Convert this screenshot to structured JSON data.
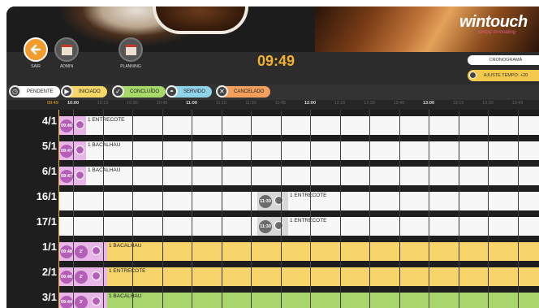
{
  "header": {
    "logo": "wintouch",
    "tagline": "simply innovating"
  },
  "toolbar": {
    "sair_label": "SAIR",
    "admin_label": "ADMIN",
    "planning_label": "PLANNING",
    "clock": "09:49",
    "cronograma_label": "CRONOGRAMA",
    "ajuste_label": "AJUSTE TEMPO: +20"
  },
  "legend": [
    {
      "label": "PENDENTE",
      "color": "#ffffff"
    },
    {
      "label": "INICIADO",
      "color": "#f7d768"
    },
    {
      "label": "CONCLUÍDO",
      "color": "#a6d96a"
    },
    {
      "label": "SERVIDO",
      "color": "#8fd3e8"
    },
    {
      "label": "CANCELADO",
      "color": "#f4a05c"
    }
  ],
  "timeline": {
    "now": "09:49",
    "ticks": [
      "10:00",
      "10:15",
      "10:30",
      "10:45",
      "11:00",
      "11:15",
      "11:30",
      "11:45",
      "12:00",
      "12:15",
      "12:30",
      "12:45",
      "13:00",
      "13:15",
      "13:30",
      "13:45"
    ],
    "rows": [
      {
        "table": "4/1",
        "time": "09:46",
        "elapsed": "",
        "item": "1 ENTRECOTE",
        "status": "pendente"
      },
      {
        "table": "5/1",
        "time": "09:47",
        "elapsed": "",
        "item": "1 BACALHAU",
        "status": "pendente"
      },
      {
        "table": "6/1",
        "time": "09:47",
        "elapsed": "",
        "item": "1 BACALHAU",
        "status": "pendente"
      },
      {
        "table": "16/1",
        "time": "11:30",
        "elapsed": "",
        "item": "1 ENTRECOTE",
        "status": "scheduled"
      },
      {
        "table": "17/1",
        "time": "11:30",
        "elapsed": "",
        "item": "1 ENTRECOTE",
        "status": "scheduled"
      },
      {
        "table": "1/1",
        "time": "09:48",
        "elapsed": "2'",
        "item": "1 BACALHAU",
        "status": "iniciado"
      },
      {
        "table": "2/1",
        "time": "09:46",
        "elapsed": "2'",
        "item": "1 ENTRECOTE",
        "status": "iniciado"
      },
      {
        "table": "3/1",
        "time": "09:44",
        "elapsed": "3'",
        "item": "1 BACALHAU",
        "status": "concluido"
      }
    ]
  },
  "colors": {
    "accent": "#f2b230",
    "badge": "#b45fb7",
    "scheduled_badge": "#6b6b6b",
    "iniciado_bar": "#f8d56b",
    "concluido_bar": "#a8d66c"
  }
}
